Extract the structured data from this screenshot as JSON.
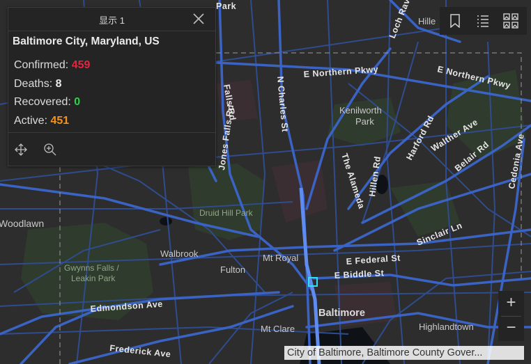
{
  "popup": {
    "title": "显示 1",
    "place": "Baltimore City, Maryland, US",
    "stats": [
      {
        "label": "Confirmed:",
        "value": "459"
      },
      {
        "label": "Deaths:",
        "value": "8"
      },
      {
        "label": "Recovered:",
        "value": "0"
      },
      {
        "label": "Active:",
        "value": "451"
      }
    ],
    "tools": [
      "move-icon",
      "zoom-to-icon"
    ]
  },
  "toolbar": {
    "icons": [
      "bookmark-icon",
      "layer-list-icon",
      "basemap-gallery-icon"
    ]
  },
  "zoom": {
    "in_label": "+",
    "out_label": "−"
  },
  "attribution": "City of Baltimore, Baltimore County Gover...",
  "colors": {
    "confirmed": "#e3263f",
    "recovered": "#2fd14a",
    "active": "#f5921e",
    "road": "#3a63c4",
    "highlight": "#2fe0f0"
  },
  "map": {
    "city_label": "Baltimore",
    "place_labels": [
      "Kenilworth",
      "Park",
      "Walbrook",
      "Fulton",
      "Mt Royal",
      "Mt Clare",
      "Highlandtown",
      "Woodlawn",
      "Hille"
    ],
    "park_labels": [
      "Druid Hill Park",
      "Gwynns Falls /",
      "Leakin Park"
    ],
    "road_labels": [
      "E Northern Pkwy",
      "E Northern Pkwy",
      "N Charles St",
      "Falls Rd",
      "Jones Falls Rd",
      "The Alameda",
      "Hillen Rd",
      "Harford Rd",
      "Walther Ave",
      "Belair Rd",
      "Cedonia Ave",
      "Sinclair Ln",
      "E Federal St",
      "E Biddle St",
      "Edmondson Ave",
      "Frederick Ave",
      "Loch Raven",
      "Park"
    ]
  }
}
